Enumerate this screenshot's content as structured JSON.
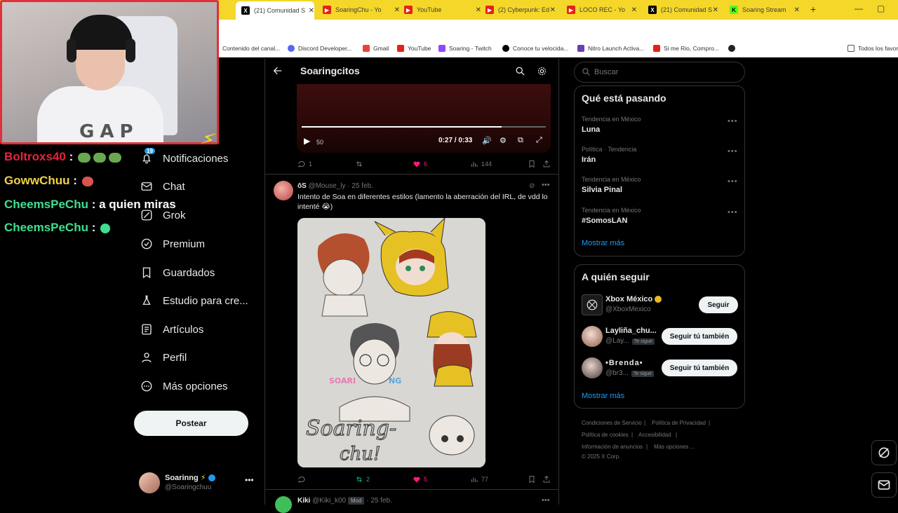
{
  "browser": {
    "tabs": [
      {
        "title": "(21) Comunidad S",
        "icon": "x-logo-icon",
        "active": true
      },
      {
        "title": "SoaringChu - Yo",
        "icon": "youtube-icon"
      },
      {
        "title": "YouTube",
        "icon": "youtube-icon"
      },
      {
        "title": "(2) Cyberpunk: Ed",
        "icon": "youtube-icon"
      },
      {
        "title": "LOCO REC - Yo",
        "icon": "youtube-icon"
      },
      {
        "title": "(21) Comunidad S",
        "icon": "x-logo-icon"
      },
      {
        "title": "Soaring Stream",
        "icon": "kick-icon"
      }
    ],
    "bookmarks": [
      "Contenido del canal...",
      "Discord Developer...",
      "Gmail",
      "YouTube",
      "Soaring - Twitch",
      "Conoce tu velocida...",
      "Nitro Launch Activa...",
      "Si me Rio, Compro..."
    ],
    "bookmarks_folder": "Todos los favor"
  },
  "chat": [
    {
      "user": "Boltroxs40",
      "msg": ""
    },
    {
      "user": "GowwChuu",
      "msg": ""
    },
    {
      "user": "CheemsPeChu",
      "msg": "a quien miras"
    },
    {
      "user": "CheemsPeChu",
      "msg": ""
    }
  ],
  "nav": {
    "notifications_badge": "19",
    "items": [
      "Notificaciones",
      "Chat",
      "Grok",
      "Premium",
      "Guardados",
      "Estudio para cre...",
      "Artículos",
      "Perfil",
      "Más opciones"
    ],
    "post_label": "Postear",
    "profile": {
      "name": "Soarinng",
      "handle": "@Soaringchuu"
    }
  },
  "center": {
    "title": "Soaringcitos",
    "video": {
      "volume": "50",
      "time": "0:27 / 0:33",
      "progress": 0.82
    },
    "post1_actions": {
      "replies": "1",
      "likes": "6",
      "views": "144"
    },
    "post2": {
      "name": "ōS",
      "handle": "@Mouse_ly",
      "date": "25 feb.",
      "text": "Intento de Soa en diferentes estilos (lamento la aberración del IRL, de vdd lo intenté 😭)",
      "drawing_text": "Soaring-chu!",
      "actions": {
        "retweets": "2",
        "likes": "5",
        "views": "77"
      }
    },
    "post3": {
      "name": "Kiki",
      "handle": "@Kiki_k00",
      "badge": "Mod",
      "date": "25 feb."
    }
  },
  "right": {
    "search_placeholder": "Buscar",
    "trends_title": "Qué está pasando",
    "trends": [
      {
        "meta": "Tendencia en México",
        "name": "Luna"
      },
      {
        "meta": "Política · Tendencia",
        "name": "Irán"
      },
      {
        "meta": "Tendencia en México",
        "name": "Silvia Pinal"
      },
      {
        "meta": "Tendencia en México",
        "name": "#SomosLAN"
      }
    ],
    "show_more": "Mostrar más",
    "who_title": "A quién seguir",
    "follows": [
      {
        "name": "Xbox México",
        "handle": "@XboxMexico",
        "button": "Seguir",
        "follows_you": ""
      },
      {
        "name": "Layliña_chu...",
        "handle": "@Lay...",
        "button": "Seguir tú también",
        "follows_you": "Te sigue"
      },
      {
        "name": "•Brenda•",
        "handle": "@br3...",
        "button": "Seguir tú también",
        "follows_you": "Te sigue"
      }
    ],
    "footer": [
      "Condiciones de Servicio",
      "Política de Privacidad",
      "Política de cookies",
      "Accesibilidad",
      "Información de anuncios",
      "Más opciones ...",
      "© 2025 X Corp."
    ]
  },
  "colors": {
    "accent": "#1d9bf0",
    "like": "#f91880",
    "retweet": "#00ba7c",
    "tabbar": "#f4d728",
    "webcam_border": "#e0303a"
  }
}
